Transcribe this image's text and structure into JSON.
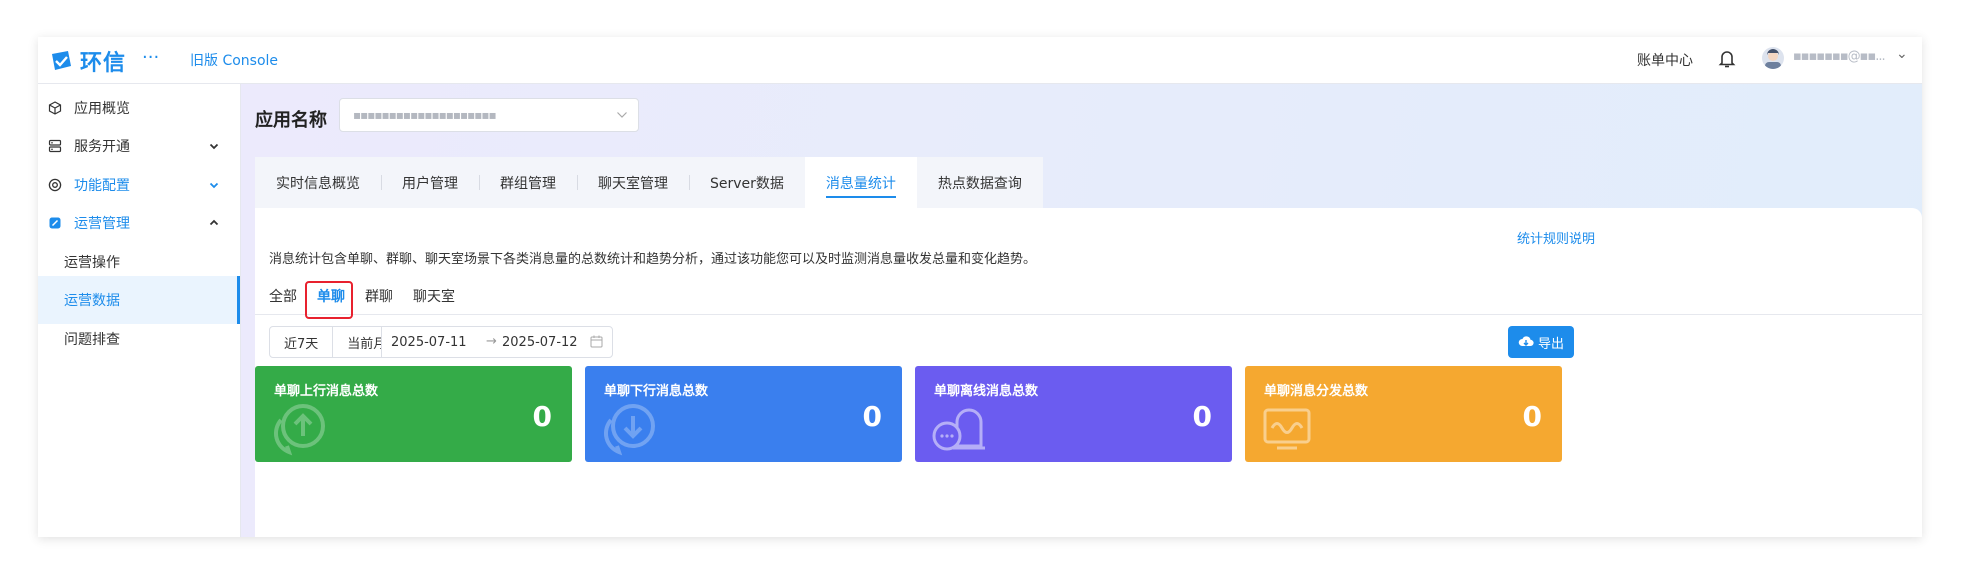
{
  "topbar": {
    "logo_text": "环信",
    "menu_dots": "···",
    "old_console": "旧版 Console",
    "bill_center": "账单中心",
    "username": "▪▪▪▪▪▪▪@▪▪..."
  },
  "sidebar": {
    "items": [
      {
        "label": "应用概览",
        "icon": "cube-icon"
      },
      {
        "label": "服务开通",
        "icon": "server-icon",
        "chevron": "down"
      },
      {
        "label": "功能配置",
        "icon": "target-icon",
        "chevron": "down"
      },
      {
        "label": "运营管理",
        "icon": "edit-square-icon",
        "chevron": "up"
      }
    ],
    "sub_items": [
      {
        "label": "运营操作"
      },
      {
        "label": "运营数据",
        "active": true
      },
      {
        "label": "问题排查"
      }
    ]
  },
  "app": {
    "label": "应用名称",
    "selected": "▪▪▪▪▪▪▪▪▪▪▪▪▪▪▪▪▪▪▪▪"
  },
  "tabs": [
    "实时信息概览",
    "用户管理",
    "群组管理",
    "聊天室管理",
    "Server数据",
    "消息量统计",
    "热点数据查询"
  ],
  "active_tab": "消息量统计",
  "panel": {
    "rule_link": "统计规则说明",
    "description": "消息统计包含单聊、群聊、聊天室场景下各类消息量的总数统计和趋势分析，通过该功能您可以及时监测消息量收发总量和变化趋势。",
    "subtabs": [
      "全部",
      "单聊",
      "群聊",
      "聊天室"
    ],
    "active_subtab": "单聊",
    "range_buttons": [
      "近7天",
      "当前月"
    ],
    "date_start": "2025-07-11",
    "date_end": "2025-07-12",
    "date_separator": "→",
    "export_label": "导出"
  },
  "cards": [
    {
      "title": "单聊上行消息总数",
      "value": "0",
      "color": "#34ab48",
      "icon": "chat-up-icon"
    },
    {
      "title": "单聊下行消息总数",
      "value": "0",
      "color": "#3a7fee",
      "icon": "chat-down-icon"
    },
    {
      "title": "单聊离线消息总数",
      "value": "0",
      "color": "#6b5cf0",
      "icon": "bell-chat-icon"
    },
    {
      "title": "单聊消息分发总数",
      "value": "0",
      "color": "#f5a830",
      "icon": "monitor-wave-icon"
    }
  ],
  "colors": {
    "primary": "#1d8ceb",
    "highlight": "#e8212e"
  }
}
